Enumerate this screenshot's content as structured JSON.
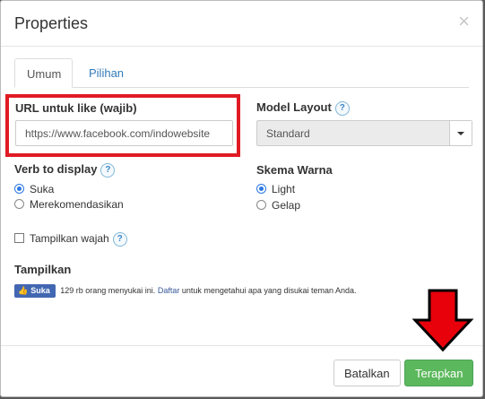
{
  "dialog": {
    "title": "Properties",
    "close_symbol": "×"
  },
  "tabs": [
    {
      "label": "Umum",
      "active": true
    },
    {
      "label": "Pilihan",
      "active": false
    }
  ],
  "url_field": {
    "label": "URL untuk like (wajib)",
    "value": "https://www.facebook.com/indowebsite"
  },
  "model_layout": {
    "label": "Model Layout",
    "help": "?",
    "selected": "Standard"
  },
  "verb": {
    "label": "Verb to display",
    "help": "?",
    "options": [
      {
        "label": "Suka",
        "checked": true
      },
      {
        "label": "Merekomendasikan",
        "checked": false
      }
    ]
  },
  "schema": {
    "label": "Skema Warna",
    "options": [
      {
        "label": "Light",
        "checked": true
      },
      {
        "label": "Gelap",
        "checked": false
      }
    ]
  },
  "show_faces": {
    "label": "Tampilkan wajah",
    "help": "?",
    "checked": false
  },
  "preview": {
    "label": "Tampilkan",
    "like_button": "Suka",
    "text_before": "129 rb orang menyukai ini.",
    "link": "Daftar",
    "text_after": "untuk mengetahui apa yang disukai teman Anda."
  },
  "footer": {
    "cancel_label": "Batalkan",
    "apply_label": "Terapkan"
  },
  "colors": {
    "highlight": "#e01b24",
    "apply": "#5cb85c",
    "facebook": "#4267b2",
    "arrow": "#e8000b"
  },
  "icons": [
    "close-icon",
    "help-icon",
    "thumbs-up-icon",
    "chevron-down-icon",
    "down-arrow-annotation-icon"
  ]
}
